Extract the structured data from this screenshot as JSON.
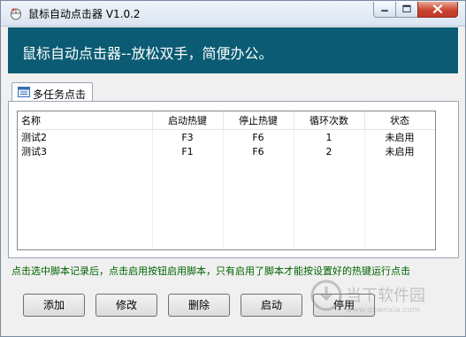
{
  "window": {
    "title": "鼠标自动点击器 V1.0.2",
    "controls": {
      "minimize": "minimize",
      "maximize": "maximize",
      "close": "close"
    }
  },
  "banner": {
    "text": "鼠标自动点击器--放松双手，简便办公。",
    "bg_color": "#0a5b73"
  },
  "tabs": [
    {
      "label": "多任务点击",
      "icon": "list-icon",
      "active": true
    }
  ],
  "table": {
    "columns": [
      "名称",
      "启动热键",
      "停止热键",
      "循环次数",
      "状态"
    ],
    "rows": [
      [
        "测试2",
        "F3",
        "F6",
        "1",
        "未启用"
      ],
      [
        "测试3",
        "F1",
        "F6",
        "2",
        "未启用"
      ]
    ]
  },
  "hint": {
    "text": "点击选中脚本记录后，点击启用按钮启用脚本，只有启用了脚本才能按设置好的热键运行点击",
    "color": "#006400"
  },
  "buttons": {
    "add": "添加",
    "edit": "修改",
    "delete": "删除",
    "start": "启动",
    "stop": "停用"
  },
  "watermark": {
    "text": "当下软件园",
    "url": "www.downxia.com"
  }
}
